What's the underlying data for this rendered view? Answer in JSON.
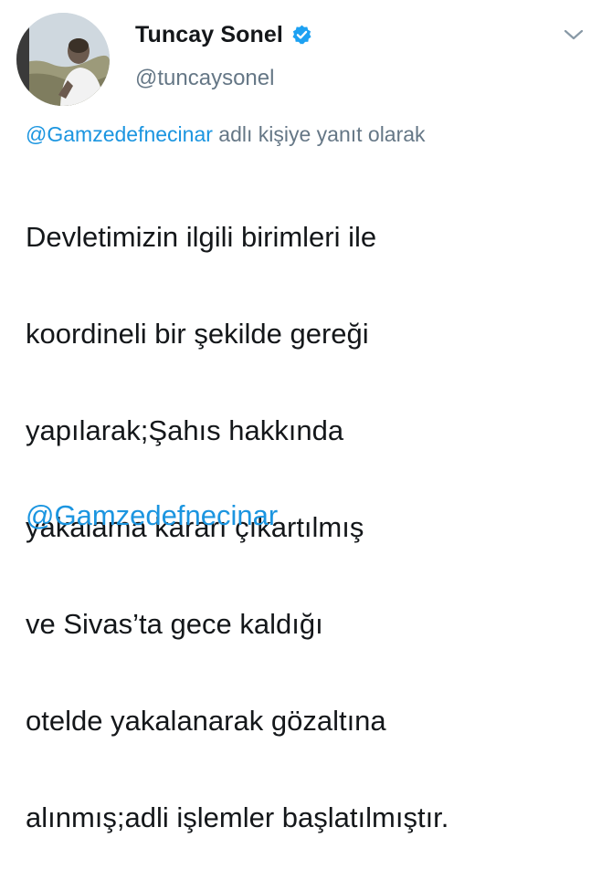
{
  "tweet": {
    "display_name": "Tuncay Sonel",
    "handle": "@tuncaysonel",
    "verified": true,
    "reply_to_mention": "@Gamzedefnecinar",
    "reply_suffix": " adlı kişiye yanıt olarak",
    "text_lines": [
      "Devletimizin ilgili birimleri ile",
      "koordineli bir şekilde gereği",
      "yapılarak;Şahıs hakkında",
      "yakalama kararı çıkartılmış",
      "ve Sivas’ta gece kaldığı",
      "otelde yakalanarak gözaltına",
      "alınmış;adli işlemler başlatılmıştır."
    ],
    "trailing_mention": "@Gamzedefnecinar"
  },
  "icons": {
    "verified": "verified-badge-icon",
    "menu": "chevron-down-icon"
  },
  "colors": {
    "link": "#1b95e0",
    "secondary_text": "#657786",
    "primary_text": "#14171a",
    "verified": "#1da1f2"
  }
}
